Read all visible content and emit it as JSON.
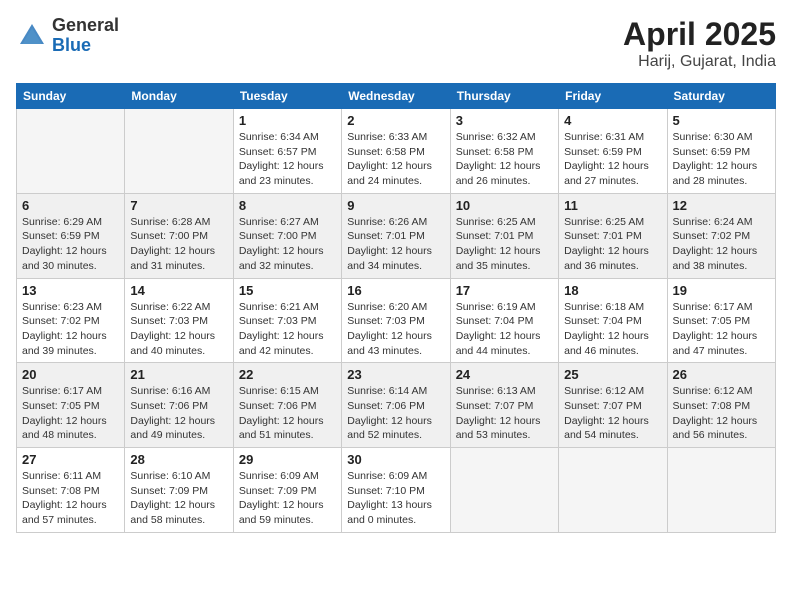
{
  "header": {
    "logo_general": "General",
    "logo_blue": "Blue",
    "month_title": "April 2025",
    "location": "Harij, Gujarat, India"
  },
  "days_of_week": [
    "Sunday",
    "Monday",
    "Tuesday",
    "Wednesday",
    "Thursday",
    "Friday",
    "Saturday"
  ],
  "weeks": [
    [
      {
        "day": "",
        "info": ""
      },
      {
        "day": "",
        "info": ""
      },
      {
        "day": "1",
        "info": "Sunrise: 6:34 AM\nSunset: 6:57 PM\nDaylight: 12 hours\nand 23 minutes."
      },
      {
        "day": "2",
        "info": "Sunrise: 6:33 AM\nSunset: 6:58 PM\nDaylight: 12 hours\nand 24 minutes."
      },
      {
        "day": "3",
        "info": "Sunrise: 6:32 AM\nSunset: 6:58 PM\nDaylight: 12 hours\nand 26 minutes."
      },
      {
        "day": "4",
        "info": "Sunrise: 6:31 AM\nSunset: 6:59 PM\nDaylight: 12 hours\nand 27 minutes."
      },
      {
        "day": "5",
        "info": "Sunrise: 6:30 AM\nSunset: 6:59 PM\nDaylight: 12 hours\nand 28 minutes."
      }
    ],
    [
      {
        "day": "6",
        "info": "Sunrise: 6:29 AM\nSunset: 6:59 PM\nDaylight: 12 hours\nand 30 minutes."
      },
      {
        "day": "7",
        "info": "Sunrise: 6:28 AM\nSunset: 7:00 PM\nDaylight: 12 hours\nand 31 minutes."
      },
      {
        "day": "8",
        "info": "Sunrise: 6:27 AM\nSunset: 7:00 PM\nDaylight: 12 hours\nand 32 minutes."
      },
      {
        "day": "9",
        "info": "Sunrise: 6:26 AM\nSunset: 7:01 PM\nDaylight: 12 hours\nand 34 minutes."
      },
      {
        "day": "10",
        "info": "Sunrise: 6:25 AM\nSunset: 7:01 PM\nDaylight: 12 hours\nand 35 minutes."
      },
      {
        "day": "11",
        "info": "Sunrise: 6:25 AM\nSunset: 7:01 PM\nDaylight: 12 hours\nand 36 minutes."
      },
      {
        "day": "12",
        "info": "Sunrise: 6:24 AM\nSunset: 7:02 PM\nDaylight: 12 hours\nand 38 minutes."
      }
    ],
    [
      {
        "day": "13",
        "info": "Sunrise: 6:23 AM\nSunset: 7:02 PM\nDaylight: 12 hours\nand 39 minutes."
      },
      {
        "day": "14",
        "info": "Sunrise: 6:22 AM\nSunset: 7:03 PM\nDaylight: 12 hours\nand 40 minutes."
      },
      {
        "day": "15",
        "info": "Sunrise: 6:21 AM\nSunset: 7:03 PM\nDaylight: 12 hours\nand 42 minutes."
      },
      {
        "day": "16",
        "info": "Sunrise: 6:20 AM\nSunset: 7:03 PM\nDaylight: 12 hours\nand 43 minutes."
      },
      {
        "day": "17",
        "info": "Sunrise: 6:19 AM\nSunset: 7:04 PM\nDaylight: 12 hours\nand 44 minutes."
      },
      {
        "day": "18",
        "info": "Sunrise: 6:18 AM\nSunset: 7:04 PM\nDaylight: 12 hours\nand 46 minutes."
      },
      {
        "day": "19",
        "info": "Sunrise: 6:17 AM\nSunset: 7:05 PM\nDaylight: 12 hours\nand 47 minutes."
      }
    ],
    [
      {
        "day": "20",
        "info": "Sunrise: 6:17 AM\nSunset: 7:05 PM\nDaylight: 12 hours\nand 48 minutes."
      },
      {
        "day": "21",
        "info": "Sunrise: 6:16 AM\nSunset: 7:06 PM\nDaylight: 12 hours\nand 49 minutes."
      },
      {
        "day": "22",
        "info": "Sunrise: 6:15 AM\nSunset: 7:06 PM\nDaylight: 12 hours\nand 51 minutes."
      },
      {
        "day": "23",
        "info": "Sunrise: 6:14 AM\nSunset: 7:06 PM\nDaylight: 12 hours\nand 52 minutes."
      },
      {
        "day": "24",
        "info": "Sunrise: 6:13 AM\nSunset: 7:07 PM\nDaylight: 12 hours\nand 53 minutes."
      },
      {
        "day": "25",
        "info": "Sunrise: 6:12 AM\nSunset: 7:07 PM\nDaylight: 12 hours\nand 54 minutes."
      },
      {
        "day": "26",
        "info": "Sunrise: 6:12 AM\nSunset: 7:08 PM\nDaylight: 12 hours\nand 56 minutes."
      }
    ],
    [
      {
        "day": "27",
        "info": "Sunrise: 6:11 AM\nSunset: 7:08 PM\nDaylight: 12 hours\nand 57 minutes."
      },
      {
        "day": "28",
        "info": "Sunrise: 6:10 AM\nSunset: 7:09 PM\nDaylight: 12 hours\nand 58 minutes."
      },
      {
        "day": "29",
        "info": "Sunrise: 6:09 AM\nSunset: 7:09 PM\nDaylight: 12 hours\nand 59 minutes."
      },
      {
        "day": "30",
        "info": "Sunrise: 6:09 AM\nSunset: 7:10 PM\nDaylight: 13 hours\nand 0 minutes."
      },
      {
        "day": "",
        "info": ""
      },
      {
        "day": "",
        "info": ""
      },
      {
        "day": "",
        "info": ""
      }
    ]
  ]
}
